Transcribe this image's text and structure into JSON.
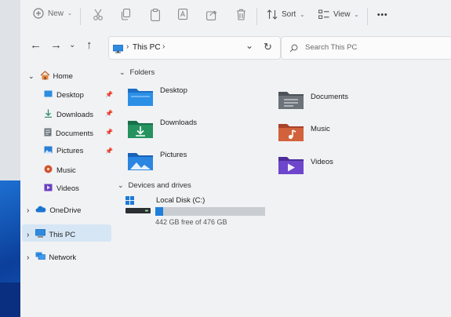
{
  "toolbar": {
    "new_label": "New",
    "sort_label": "Sort",
    "view_label": "View",
    "more_label": "•••"
  },
  "address": {
    "location": "This PC",
    "search_placeholder": "Search This PC"
  },
  "nav": {
    "home": "Home",
    "quick": [
      {
        "label": "Desktop",
        "pinned": true
      },
      {
        "label": "Downloads",
        "pinned": true
      },
      {
        "label": "Documents",
        "pinned": true
      },
      {
        "label": "Pictures",
        "pinned": true
      },
      {
        "label": "Music",
        "pinned": false
      },
      {
        "label": "Videos",
        "pinned": false
      }
    ],
    "onedrive": "OneDrive",
    "thispc": "This PC",
    "network": "Network"
  },
  "main": {
    "folders_header": "Folders",
    "folders": [
      {
        "name": "Desktop",
        "icon": "desktop-folder-icon"
      },
      {
        "name": "Documents",
        "icon": "documents-folder-icon"
      },
      {
        "name": "Downloads",
        "icon": "downloads-folder-icon"
      },
      {
        "name": "Music",
        "icon": "music-folder-icon"
      },
      {
        "name": "Pictures",
        "icon": "pictures-folder-icon"
      },
      {
        "name": "Videos",
        "icon": "videos-folder-icon"
      }
    ],
    "devices_header": "Devices and drives",
    "drive": {
      "name": "Local Disk (C:)",
      "free": "442 GB free of 476 GB",
      "used_fraction": 0.07
    }
  },
  "colors": {
    "accent": "#1a78d4",
    "selection": "#d7e6f5",
    "usage_bar": "#1e7fd8",
    "usage_track": "#c9ccd1"
  }
}
